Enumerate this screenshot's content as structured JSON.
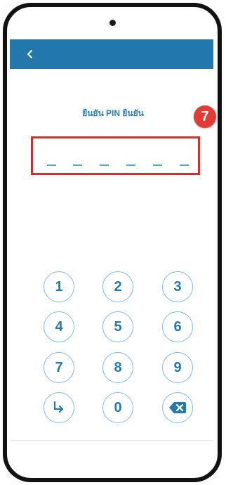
{
  "screen": {
    "title": "ยืนยัน PIN ยืนยัน",
    "step_badge": "7",
    "pin_length": 6
  },
  "keypad": {
    "keys": [
      {
        "name": "key-1",
        "label": "1"
      },
      {
        "name": "key-2",
        "label": "2"
      },
      {
        "name": "key-3",
        "label": "3"
      },
      {
        "name": "key-4",
        "label": "4"
      },
      {
        "name": "key-5",
        "label": "5"
      },
      {
        "name": "key-6",
        "label": "6"
      },
      {
        "name": "key-7",
        "label": "7"
      },
      {
        "name": "key-8",
        "label": "8"
      },
      {
        "name": "key-9",
        "label": "9"
      },
      {
        "name": "enter-key",
        "icon": "enter-arrow-icon"
      },
      {
        "name": "key-0",
        "label": "0"
      },
      {
        "name": "backspace-key",
        "icon": "backspace-icon"
      }
    ]
  },
  "colors": {
    "accent": "#2278aa",
    "key_text": "#2478b5",
    "highlight": "#d32f2f",
    "badge": "#e53935"
  }
}
